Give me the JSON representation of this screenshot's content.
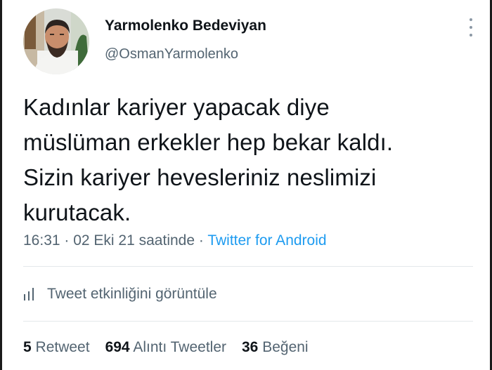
{
  "user": {
    "display_name": "Yarmolenko Bedeviyan",
    "handle": "@OsmanYarmolenko",
    "avatar_icon": "profile-photo"
  },
  "tweet": {
    "lines": [
      "Kadınlar kariyer yapacak diye",
      "müslüman erkekler hep bekar kaldı.",
      "Sizin kariyer hevesleriniz neslimizi",
      "kurutacak."
    ]
  },
  "meta": {
    "time": "16:31",
    "separator1": " · ",
    "date": "02 Eki 21 saatinde",
    "separator2": " · ",
    "source": "Twitter for Android"
  },
  "activity": {
    "icon": "chart-bars-icon",
    "label": "Tweet etkinliğini görüntüle"
  },
  "stats": {
    "retweets_count": "5",
    "retweets_label": "Retweet",
    "quotes_count": "694",
    "quotes_label": "Alıntı Tweetler",
    "likes_count": "36",
    "likes_label": "Beğeni"
  },
  "colors": {
    "text_primary": "#0f1419",
    "text_secondary": "#536471",
    "link": "#1d9bf0",
    "divider": "#e4e8eb"
  }
}
